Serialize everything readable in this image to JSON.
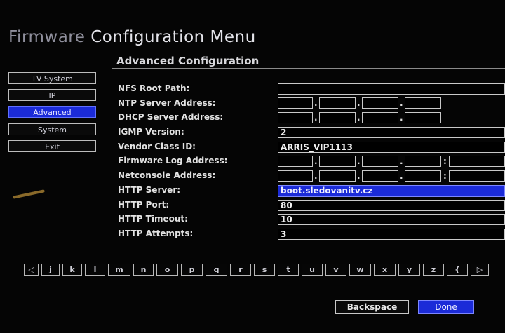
{
  "header": {
    "title_part1": "Firmware",
    "title_part2": "Configuration Menu",
    "subtitle": "Advanced Configuration"
  },
  "menu": {
    "items": [
      {
        "label": "TV System"
      },
      {
        "label": "IP"
      },
      {
        "label": "Advanced",
        "active": true
      },
      {
        "label": "System"
      },
      {
        "label": "Exit"
      }
    ]
  },
  "form": {
    "nfs_root_path": {
      "label": "NFS Root Path:",
      "value": ""
    },
    "ntp_server": {
      "label": "NTP Server Address:"
    },
    "dhcp_server": {
      "label": "DHCP Server Address:"
    },
    "igmp_version": {
      "label": "IGMP Version:",
      "value": "2"
    },
    "vendor_class_id": {
      "label": "Vendor Class ID:",
      "value": "ARRIS_VIP1113"
    },
    "firmware_log": {
      "label": "Firmware Log Address:"
    },
    "netconsole": {
      "label": "Netconsole Address:"
    },
    "http_server": {
      "label": "HTTP Server:",
      "value": "boot.sledovanitv.cz"
    },
    "http_port": {
      "label": "HTTP Port:",
      "value": "80"
    },
    "http_timeout": {
      "label": "HTTP Timeout:",
      "value": "10"
    },
    "http_attempts": {
      "label": "HTTP Attempts:",
      "value": "3"
    }
  },
  "keyboard": {
    "keys": [
      "◁",
      "j",
      "k",
      "l",
      "m",
      "n",
      "o",
      "p",
      "q",
      "r",
      "s",
      "t",
      "u",
      "v",
      "w",
      "x",
      "y",
      "z",
      "{",
      "▷"
    ]
  },
  "buttons": {
    "backspace": "Backspace",
    "done": "Done"
  },
  "colors": {
    "highlight": "#1b2bd8",
    "background": "#000000"
  }
}
